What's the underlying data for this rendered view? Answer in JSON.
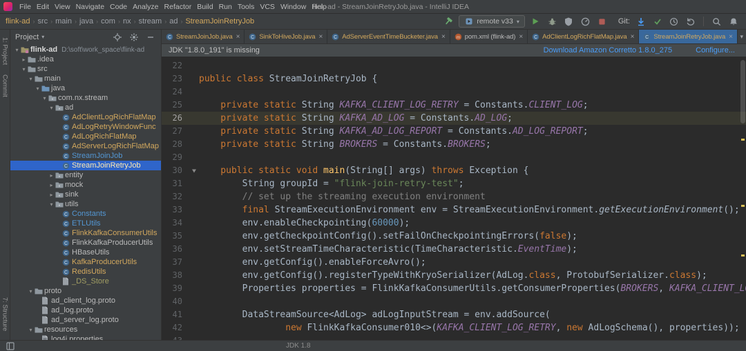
{
  "window": {
    "title": "flink-ad - StreamJoinRetryJob.java - IntelliJ IDEA"
  },
  "menu_bar": {
    "items": [
      "File",
      "Edit",
      "View",
      "Navigate",
      "Code",
      "Analyze",
      "Refactor",
      "Build",
      "Run",
      "Tools",
      "VCS",
      "Window",
      "Help"
    ]
  },
  "toolbar": {
    "breadcrumbs": [
      {
        "label": "flink-ad",
        "color": "yellow"
      },
      {
        "label": "src",
        "color": "default"
      },
      {
        "label": "main",
        "color": "default"
      },
      {
        "label": "java",
        "color": "default"
      },
      {
        "label": "com",
        "color": "default"
      },
      {
        "label": "nx",
        "color": "default"
      },
      {
        "label": "stream",
        "color": "default"
      },
      {
        "label": "ad",
        "color": "default"
      },
      {
        "label": "StreamJoinRetryJob",
        "color": "yellow"
      }
    ],
    "left_icons": [
      "build-hammer-icon"
    ],
    "run_config_label": "remote v33",
    "run_icons": [
      "run-icon",
      "debug-icon",
      "coverage-icon",
      "profiler-icon",
      "stop-icon"
    ],
    "git_label": "Git:",
    "git_icons": [
      "update-project-icon",
      "commit-icon",
      "history-icon",
      "rollback-icon"
    ],
    "far_icons": [
      "search-everywhere-icon",
      "notifications-icon"
    ]
  },
  "left_strip": {
    "top": [
      "1: Project",
      "Commit"
    ],
    "bottom": [
      "7: Structure"
    ]
  },
  "project_panel": {
    "title": "Project",
    "header_icons": [
      "locate-icon",
      "gear-icon",
      "hide-icon"
    ],
    "tree": [
      {
        "label": "flink-ad",
        "suffix": "D:\\soft\\work_space\\flink-ad",
        "depth": 0,
        "icon": "project-folder-icon",
        "arrow": "open",
        "color": "bright"
      },
      {
        "label": ".idea",
        "depth": 1,
        "icon": "folder-icon",
        "arrow": "closed",
        "color": "default"
      },
      {
        "label": "src",
        "depth": 1,
        "icon": "folder-icon",
        "arrow": "open",
        "color": "default"
      },
      {
        "label": "main",
        "depth": 2,
        "icon": "folder-icon",
        "arrow": "open",
        "color": "default"
      },
      {
        "label": "java",
        "depth": 3,
        "icon": "source-folder-icon",
        "arrow": "open",
        "color": "default"
      },
      {
        "label": "com.nx.stream",
        "depth": 4,
        "icon": "package-icon",
        "arrow": "open",
        "color": "default"
      },
      {
        "label": "ad",
        "depth": 5,
        "icon": "package-icon",
        "arrow": "open",
        "color": "default"
      },
      {
        "label": "AdClientLogRichFlatMap",
        "depth": 6,
        "icon": "class-icon",
        "arrow": "none",
        "color": "yellow"
      },
      {
        "label": "AdLogRetryWindowFunc",
        "depth": 6,
        "icon": "class-icon",
        "arrow": "none",
        "color": "yellow"
      },
      {
        "label": "AdLogRichFlatMap",
        "depth": 6,
        "icon": "class-icon",
        "arrow": "none",
        "color": "yellow"
      },
      {
        "label": "AdServerLogRichFlatMap",
        "depth": 6,
        "icon": "class-icon",
        "arrow": "none",
        "color": "yellow"
      },
      {
        "label": "StreamJoinJob",
        "depth": 6,
        "icon": "class-icon",
        "arrow": "none",
        "color": "blue"
      },
      {
        "label": "StreamJoinRetryJob",
        "depth": 6,
        "icon": "class-icon",
        "arrow": "none",
        "color": "yellow",
        "selected": true
      },
      {
        "label": "entity",
        "depth": 5,
        "icon": "package-icon",
        "arrow": "closed",
        "color": "default"
      },
      {
        "label": "mock",
        "depth": 5,
        "icon": "package-icon",
        "arrow": "closed",
        "color": "default"
      },
      {
        "label": "sink",
        "depth": 5,
        "icon": "package-icon",
        "arrow": "closed",
        "color": "default"
      },
      {
        "label": "utils",
        "depth": 5,
        "icon": "package-icon",
        "arrow": "open",
        "color": "default"
      },
      {
        "label": "Constants",
        "depth": 6,
        "icon": "class-icon",
        "arrow": "none",
        "color": "blue"
      },
      {
        "label": "ETLUtils",
        "depth": 6,
        "icon": "class-icon",
        "arrow": "none",
        "color": "blue"
      },
      {
        "label": "FlinkKafkaConsumerUtils",
        "depth": 6,
        "icon": "class-icon",
        "arrow": "none",
        "color": "yellow"
      },
      {
        "label": "FlinkKafkaProducerUtils",
        "depth": 6,
        "icon": "class-icon",
        "arrow": "none",
        "color": "default"
      },
      {
        "label": "HBaseUtils",
        "depth": 6,
        "icon": "class-icon",
        "arrow": "none",
        "color": "default"
      },
      {
        "label": "KafkaProducerUtils",
        "depth": 6,
        "icon": "class-icon",
        "arrow": "none",
        "color": "yellow"
      },
      {
        "label": "RedisUtils",
        "depth": 6,
        "icon": "class-icon",
        "arrow": "none",
        "color": "yellow"
      },
      {
        "label": "_DS_Store",
        "depth": 6,
        "icon": "file-icon",
        "arrow": "none",
        "color": "olive"
      },
      {
        "label": "proto",
        "depth": 2,
        "icon": "folder-icon",
        "arrow": "open",
        "color": "default"
      },
      {
        "label": "ad_client_log.proto",
        "depth": 3,
        "icon": "file-icon",
        "arrow": "none",
        "color": "default"
      },
      {
        "label": "ad_log.proto",
        "depth": 3,
        "icon": "file-icon",
        "arrow": "none",
        "color": "default"
      },
      {
        "label": "ad_server_log.proto",
        "depth": 3,
        "icon": "file-icon",
        "arrow": "none",
        "color": "default"
      },
      {
        "label": "resources",
        "depth": 2,
        "icon": "folder-icon",
        "arrow": "open",
        "color": "default"
      },
      {
        "label": "log4j.properties",
        "depth": 3,
        "icon": "properties-icon",
        "arrow": "none",
        "color": "default"
      }
    ]
  },
  "editor": {
    "tabs": [
      {
        "label": "StreamJoinJob.java",
        "icon": "class-icon",
        "color": "yellow"
      },
      {
        "label": "SinkToHiveJob.java",
        "icon": "class-icon",
        "color": "yellow"
      },
      {
        "label": "AdServerEventTimeBucketer.java",
        "icon": "class-icon",
        "color": "yellow"
      },
      {
        "label": "pom.xml (flink-ad)",
        "icon": "maven-icon",
        "color": "default"
      },
      {
        "label": "AdClientLogRichFlatMap.java",
        "icon": "class-icon",
        "color": "yellow"
      },
      {
        "label": "StreamJoinRetryJob.java",
        "icon": "class-icon",
        "color": "yellow",
        "selected": true
      }
    ],
    "banner": {
      "message": "JDK \"1.8.0_191\" is missing",
      "links": [
        "Download Amazon Corretto 1.8.0_275",
        "Configure..."
      ]
    },
    "code": {
      "lines": [
        {
          "n": 22,
          "s": []
        },
        {
          "n": 23,
          "s": [
            [
              "k",
              "public class "
            ],
            [
              "d",
              "StreamJoinRetryJob {"
            ]
          ]
        },
        {
          "n": 24,
          "s": []
        },
        {
          "n": 25,
          "s": [
            [
              "k",
              "    private static "
            ],
            [
              "d",
              "String "
            ],
            [
              "f",
              "KAFKA_CLIENT_LOG_RETRY"
            ],
            [
              "d",
              " = Constants."
            ],
            [
              "f",
              "CLIENT_LOG"
            ],
            [
              "d",
              ";"
            ]
          ]
        },
        {
          "n": 26,
          "current": true,
          "s": [
            [
              "k",
              "    private static "
            ],
            [
              "d",
              "String "
            ],
            [
              "f",
              "KAFKA_AD_LOG"
            ],
            [
              "d",
              " = Constants."
            ],
            [
              "f",
              "AD_LOG"
            ],
            [
              "d",
              ";"
            ]
          ]
        },
        {
          "n": 27,
          "s": [
            [
              "k",
              "    private static "
            ],
            [
              "d",
              "String "
            ],
            [
              "f",
              "KAFKA_AD_LOG_REPORT"
            ],
            [
              "d",
              " = Constants."
            ],
            [
              "f",
              "AD_LOG_REPORT"
            ],
            [
              "d",
              ";"
            ]
          ]
        },
        {
          "n": 28,
          "s": [
            [
              "k",
              "    private static "
            ],
            [
              "d",
              "String "
            ],
            [
              "f",
              "BROKERS"
            ],
            [
              "d",
              " = Constants."
            ],
            [
              "f",
              "BROKERS"
            ],
            [
              "d",
              ";"
            ]
          ]
        },
        {
          "n": 29,
          "s": []
        },
        {
          "n": 30,
          "marker": true,
          "s": [
            [
              "k",
              "    public static void "
            ],
            [
              "m",
              "main"
            ],
            [
              "d",
              "(String[] args) "
            ],
            [
              "k",
              "throws "
            ],
            [
              "d",
              "Exception {"
            ]
          ]
        },
        {
          "n": 31,
          "s": [
            [
              "d",
              "        String groupId = "
            ],
            [
              "s",
              "\"flink-join-retry-test\""
            ],
            [
              "d",
              ";"
            ]
          ]
        },
        {
          "n": 32,
          "s": [
            [
              "c",
              "        // set up the streaming execution environment"
            ]
          ]
        },
        {
          "n": 33,
          "s": [
            [
              "k",
              "        final "
            ],
            [
              "d",
              "StreamExecutionEnvironment env = StreamExecutionEnvironment."
            ],
            [
              "i",
              "getExecutionEnvironment"
            ],
            [
              "d",
              "();"
            ]
          ]
        },
        {
          "n": 34,
          "s": [
            [
              "d",
              "        env.enableCheckpointing("
            ],
            [
              "num",
              "60000"
            ],
            [
              "d",
              ");"
            ]
          ]
        },
        {
          "n": 35,
          "s": [
            [
              "d",
              "        env.getCheckpointConfig().setFailOnCheckpointingErrors("
            ],
            [
              "k",
              "false"
            ],
            [
              "d",
              ");"
            ]
          ]
        },
        {
          "n": 36,
          "s": [
            [
              "d",
              "        env.setStreamTimeCharacteristic(TimeCharacteristic."
            ],
            [
              "f",
              "EventTime"
            ],
            [
              "d",
              ");"
            ]
          ]
        },
        {
          "n": 37,
          "s": [
            [
              "d",
              "        env.getConfig().enableForceAvro();"
            ]
          ]
        },
        {
          "n": 38,
          "s": [
            [
              "d",
              "        env.getConfig().registerTypeWithKryoSerializer(AdLog."
            ],
            [
              "k",
              "class"
            ],
            [
              "d",
              ", ProtobufSerializer."
            ],
            [
              "k",
              "class"
            ],
            [
              "d",
              ");"
            ]
          ]
        },
        {
          "n": 39,
          "s": [
            [
              "d",
              "        Properties properties = FlinkKafkaConsumerUtils.getConsumerProperties("
            ],
            [
              "f",
              "BROKERS"
            ],
            [
              "d",
              ", "
            ],
            [
              "f",
              "KAFKA_CLIENT_LOG_RETRY"
            ],
            [
              "d",
              ");"
            ]
          ]
        },
        {
          "n": 40,
          "s": []
        },
        {
          "n": 41,
          "s": [
            [
              "d",
              "        DataStreamSource<AdLog> adLogInputStream = env.addSource("
            ]
          ]
        },
        {
          "n": 42,
          "s": [
            [
              "d",
              "                "
            ],
            [
              "k",
              "new "
            ],
            [
              "d",
              "FlinkKafkaConsumer010<>("
            ],
            [
              "f",
              "KAFKA_CLIENT_LOG_RETRY"
            ],
            [
              "d",
              ", "
            ],
            [
              "k",
              "new "
            ],
            [
              "d",
              "AdLogSchema(), properties));"
            ]
          ]
        },
        {
          "n": 43,
          "s": []
        }
      ]
    }
  },
  "status_bar": {
    "message": "JDK 1.8"
  },
  "colors": {
    "background_editor": "#2b2b2b",
    "background_panel": "#3c3f41",
    "selection_blue": "#2f65ca",
    "tab_selected_blue": "#39689c",
    "accent_link_blue": "#4a9df8",
    "modified_yellow": "#d2a85e",
    "changed_blue": "#5396d2",
    "olive": "#a29e63",
    "keyword_orange": "#cc7832",
    "string_green": "#6a8759",
    "number_blue": "#6897bb",
    "comment_gray": "#808080",
    "field_purple": "#9876aa",
    "method_yellow": "#ffc66b",
    "code_default": "#a9b7c6",
    "line_number_gray": "#606366"
  }
}
